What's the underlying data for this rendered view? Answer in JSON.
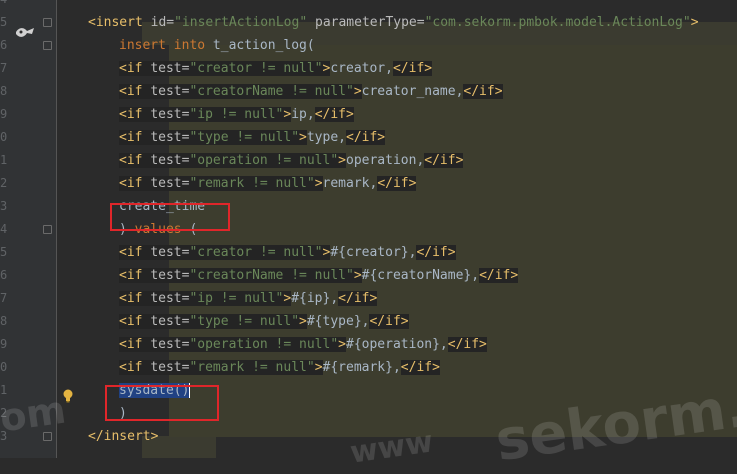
{
  "line_numbers": [
    "4",
    "5",
    "6",
    "7",
    "8",
    "9",
    "0",
    "1",
    "2",
    "3",
    "4",
    "5",
    "6",
    "7",
    "8",
    "9",
    "0",
    "1",
    "2",
    "3"
  ],
  "code": {
    "l5_open": "<insert ",
    "l5_attr1": "id=",
    "l5_val1": "\"insertActionLog\"",
    "l5_attr2": " parameterType=",
    "l5_val2": "\"com.sekorm.pmbok.model.ActionLog\"",
    "l5_close": ">",
    "l6": "insert into t_action_log(",
    "l6_kw": "insert into ",
    "l6_rest": "t_action_log(",
    "l7_test": "\"creator != null\"",
    "l7_body": "creator,",
    "l8_test": "\"creatorName != null\"",
    "l8_body": "creator_name,",
    "l9_test": "\"ip != null\"",
    "l9_body": "ip,",
    "l10_test": "\"type != null\"",
    "l10_body": "type,",
    "l11_test": "\"operation != null\"",
    "l11_body": "operation,",
    "l12_test": "\"remark != null\"",
    "l12_body": "remark,",
    "l13": "create_time",
    "l14_a": ") ",
    "l14_kw": "values",
    "l14_b": " (",
    "l15_test": "\"creator != null\"",
    "l15_body": "#{creator},",
    "l16_test": "\"creatorName != null\"",
    "l16_body": "#{creatorName},",
    "l17_test": "\"ip != null\"",
    "l17_body": "#{ip},",
    "l18_test": "\"type != null\"",
    "l18_body": "#{type},",
    "l19_test": "\"operation != null\"",
    "l19_body": "#{operation},",
    "l20_test": "\"remark != null\"",
    "l20_body": "#{remark},",
    "l21": "sysdate()",
    "l22": ")",
    "l23": "</insert>",
    "if_open": "<if ",
    "test_attr": "test=",
    "gt": ">",
    "if_close": "</if>"
  },
  "watermark": {
    "main": "sekorm.",
    "sub": "www",
    "left": "om"
  },
  "colors": {
    "tag": "#e8bf6a",
    "string": "#6a8759",
    "keyword": "#cc7832",
    "text": "#a9b7c6",
    "highlight_box": "#e0262a"
  }
}
